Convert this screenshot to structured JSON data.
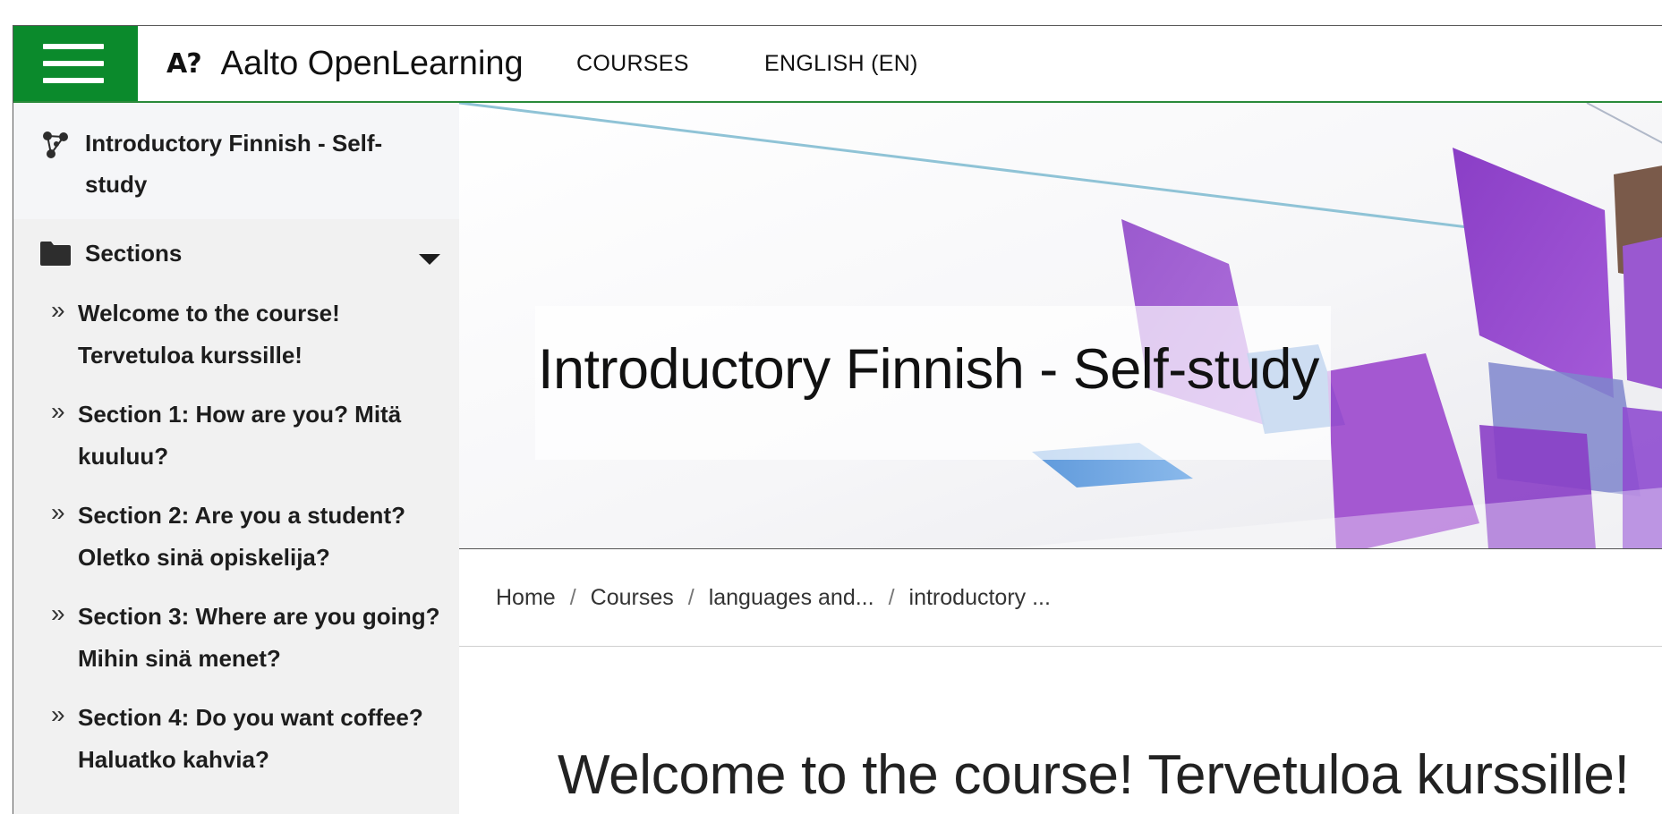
{
  "navbar": {
    "brand_mark": "A?",
    "brand_name": "Aalto OpenLearning",
    "links": [
      "COURSES",
      "ENGLISH (EN)"
    ]
  },
  "sidebar": {
    "course_title": "Introductory Finnish - Self-study",
    "sections_label": "Sections",
    "items": [
      "Welcome to the course! Tervetuloa kurssille!",
      "Section 1: How are you? Mitä kuuluu?",
      "Section 2: Are you a student? Oletko sinä opiskelija?",
      "Section 3: Where are you going? Mihin sinä menet?",
      "Section 4: Do you want coffee? Haluatko kahvia?"
    ]
  },
  "hero": {
    "title": "Introductory Finnish - Self-study"
  },
  "breadcrumb": [
    "Home",
    "Courses",
    "languages and...",
    "introductory ..."
  ],
  "main": {
    "heading": "Welcome to the course! Tervetuloa kurssille!"
  },
  "colors": {
    "brand_green": "#0b8a2c",
    "sidebar_bg": "#f1f1f1"
  }
}
